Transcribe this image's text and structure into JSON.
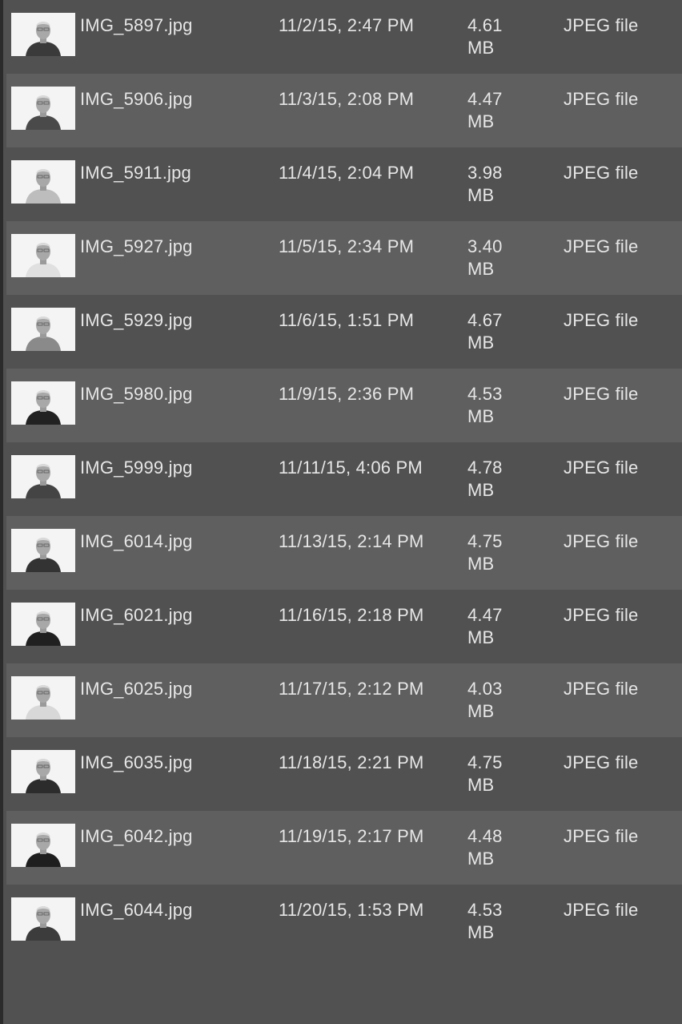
{
  "files": [
    {
      "name": "IMG_5897.jpg",
      "date": "11/2/15, 2:47 PM",
      "size_value": "4.61",
      "size_unit": "MB",
      "kind": "JPEG file"
    },
    {
      "name": "IMG_5906.jpg",
      "date": "11/3/15, 2:08 PM",
      "size_value": "4.47",
      "size_unit": "MB",
      "kind": "JPEG file"
    },
    {
      "name": "IMG_5911.jpg",
      "date": "11/4/15, 2:04 PM",
      "size_value": "3.98",
      "size_unit": "MB",
      "kind": "JPEG file"
    },
    {
      "name": "IMG_5927.jpg",
      "date": "11/5/15, 2:34 PM",
      "size_value": "3.40",
      "size_unit": "MB",
      "kind": "JPEG file"
    },
    {
      "name": "IMG_5929.jpg",
      "date": "11/6/15, 1:51 PM",
      "size_value": "4.67",
      "size_unit": "MB",
      "kind": "JPEG file"
    },
    {
      "name": "IMG_5980.jpg",
      "date": "11/9/15, 2:36 PM",
      "size_value": "4.53",
      "size_unit": "MB",
      "kind": "JPEG file"
    },
    {
      "name": "IMG_5999.jpg",
      "date": "11/11/15, 4:06 PM",
      "size_value": "4.78",
      "size_unit": "MB",
      "kind": "JPEG file"
    },
    {
      "name": "IMG_6014.jpg",
      "date": "11/13/15, 2:14 PM",
      "size_value": "4.75",
      "size_unit": "MB",
      "kind": "JPEG file"
    },
    {
      "name": "IMG_6021.jpg",
      "date": "11/16/15, 2:18 PM",
      "size_value": "4.47",
      "size_unit": "MB",
      "kind": "JPEG file"
    },
    {
      "name": "IMG_6025.jpg",
      "date": "11/17/15, 2:12 PM",
      "size_value": "4.03",
      "size_unit": "MB",
      "kind": "JPEG file"
    },
    {
      "name": "IMG_6035.jpg",
      "date": "11/18/15, 2:21 PM",
      "size_value": "4.75",
      "size_unit": "MB",
      "kind": "JPEG file"
    },
    {
      "name": "IMG_6042.jpg",
      "date": "11/19/15, 2:17 PM",
      "size_value": "4.48",
      "size_unit": "MB",
      "kind": "JPEG file"
    },
    {
      "name": "IMG_6044.jpg",
      "date": "11/20/15, 1:53 PM",
      "size_value": "4.53",
      "size_unit": "MB",
      "kind": "JPEG file"
    }
  ],
  "colors": {
    "row_odd": "#515151",
    "row_even": "#5f5f5f",
    "text": "#e6e6e6",
    "left_border": "#2b2b2b"
  },
  "icons": {
    "thumbnail": "photo-thumbnail-icon"
  }
}
